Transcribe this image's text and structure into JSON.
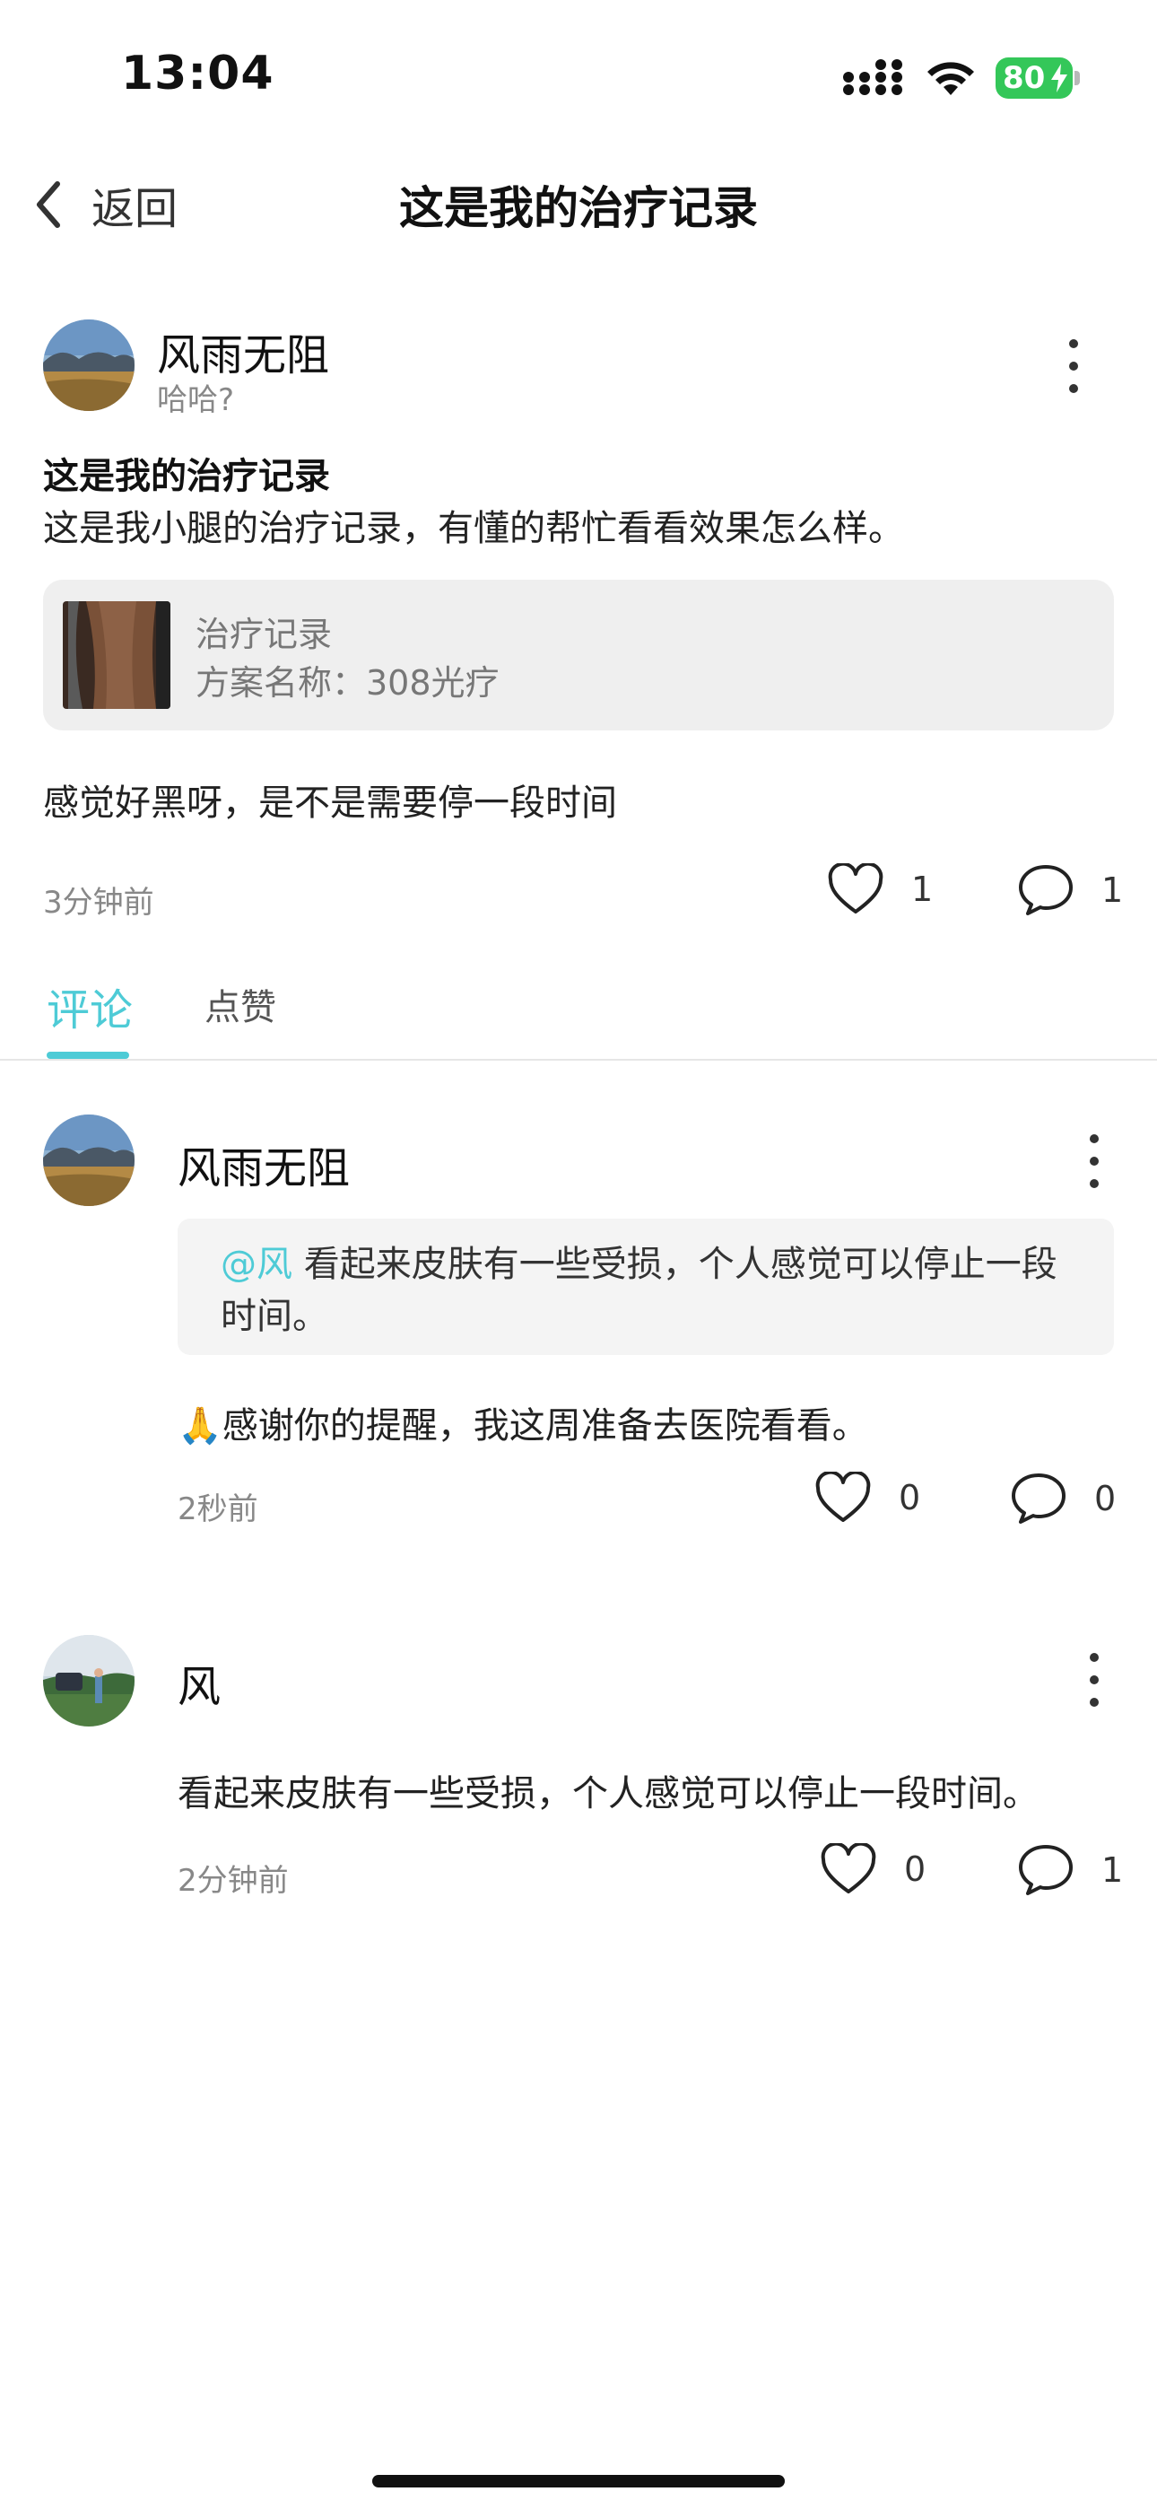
{
  "status_bar": {
    "time": "13:04",
    "battery": "80",
    "icons": [
      "signal-icon",
      "wifi-icon",
      "battery-charging-icon"
    ]
  },
  "nav": {
    "back_label": "返回",
    "title": "这是我的治疗记录"
  },
  "post": {
    "author": "风雨无阻",
    "author_sub": "哈哈?",
    "title": "这是我的治疗记录",
    "body": "这是我小腿的治疗记录，有懂的帮忙看看效果怎么样。",
    "record_card": {
      "title": "治疗记录",
      "subtitle": "方案名称：308光疗"
    },
    "note": "感觉好黑呀，是不是需要停一段时间",
    "time": "3分钟前",
    "likes": "1",
    "comments": "1"
  },
  "tabs": [
    {
      "label": "评论",
      "active": true
    },
    {
      "label": "点赞",
      "active": false
    }
  ],
  "comments": [
    {
      "author": "风雨无阻",
      "quote_mention": "@风",
      "quote_text": " 看起来皮肤有一些受损，个人感觉可以停止一段时间。",
      "text": "🙏感谢你的提醒，我这周准备去医院看看。",
      "time": "2秒前",
      "likes": "0",
      "replies": "0"
    },
    {
      "author": "风",
      "text": "看起来皮肤有一些受损，个人感觉可以停止一段时间。",
      "time": "2分钟前",
      "likes": "0",
      "replies": "1"
    }
  ],
  "colors": {
    "accent": "#4ecbd6",
    "battery": "#34c759",
    "card_bg": "#efefef",
    "quote_bg": "#f4f4f4"
  }
}
